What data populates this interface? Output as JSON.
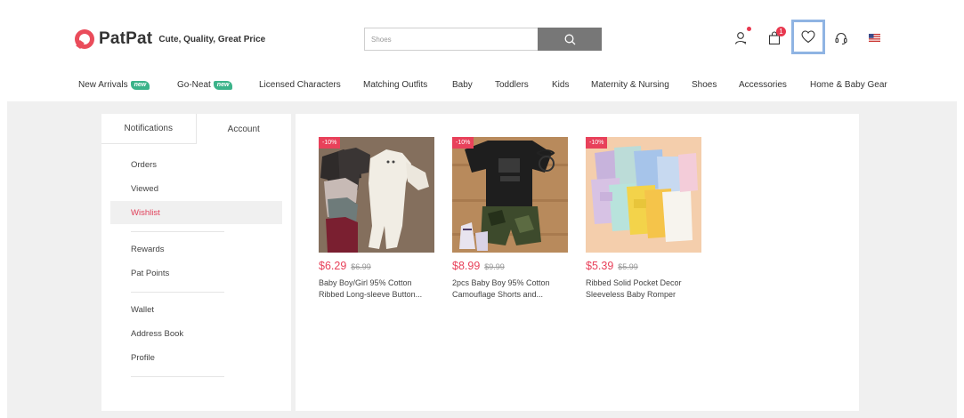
{
  "header": {
    "brand": "PatPat",
    "slogan": "Cute, Quality, Great Price",
    "search_placeholder": "Shoes",
    "cart_count": "1"
  },
  "nav": {
    "items": [
      {
        "label": "New Arrivals",
        "tag": "new"
      },
      {
        "label": "Go-Neat",
        "tag": "new"
      },
      {
        "label": "Licensed Characters"
      },
      {
        "label": "Matching Outfits"
      },
      {
        "label": "Baby"
      },
      {
        "label": "Toddlers"
      },
      {
        "label": "Kids"
      },
      {
        "label": "Maternity & Nursing"
      },
      {
        "label": "Shoes"
      },
      {
        "label": "Accessories"
      },
      {
        "label": "Home & Baby Gear"
      }
    ]
  },
  "sidebar": {
    "tabs": [
      "Notifications",
      "Account"
    ],
    "menu": [
      {
        "label": "Orders"
      },
      {
        "label": "Viewed"
      },
      {
        "label": "Wishlist",
        "active": true
      },
      {
        "label": "Rewards"
      },
      {
        "label": "Pat Points"
      },
      {
        "label": "Wallet"
      },
      {
        "label": "Address Book"
      },
      {
        "label": "Profile"
      }
    ]
  },
  "wishlist": {
    "products": [
      {
        "discount": "-10%",
        "price": "$6.29",
        "old_price": "$6.99",
        "title_line1": "Baby Boy/Girl 95% Cotton",
        "title_line2": "Ribbed Long-sleeve Button..."
      },
      {
        "discount": "-10%",
        "price": "$8.99",
        "old_price": "$9.99",
        "title_line1": "2pcs Baby Boy 95% Cotton",
        "title_line2": "Camouflage Shorts and..."
      },
      {
        "discount": "-10%",
        "price": "$5.39",
        "old_price": "$5.99",
        "title_line1": "Ribbed Solid Pocket Decor",
        "title_line2": "Sleeveless Baby Romper"
      }
    ]
  },
  "colors": {
    "brand": "#ea4c5b",
    "accent_new": "#3cb38a",
    "highlight_box": "#8fb4e3"
  }
}
